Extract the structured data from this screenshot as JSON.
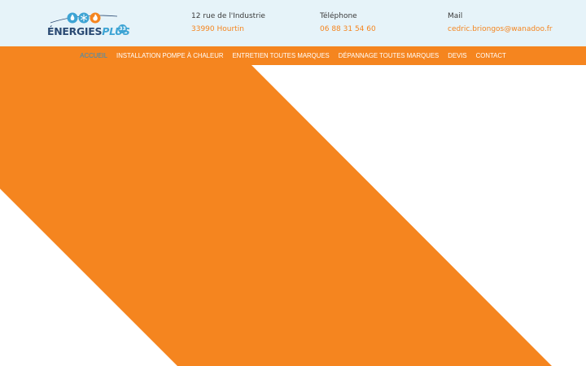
{
  "header": {
    "logo": {
      "word1": "ÉNERGIES",
      "word2": "PLUS",
      "badge": "33",
      "alt_icons": [
        "water-drop-icon",
        "snowflake-icon",
        "flame-icon"
      ]
    },
    "address": {
      "label": "12 rue de l'Industrie",
      "value": "33990 Hourtin"
    },
    "phone": {
      "label": "Téléphone",
      "value": "06 88 31 54 60"
    },
    "mail": {
      "label": "Mail",
      "value": "cedric.briongos@wanadoo.fr"
    }
  },
  "nav": {
    "items": [
      {
        "label": "ACCUEIL",
        "active": true
      },
      {
        "label": "INSTALLATION POMPE À CHALEUR",
        "active": false
      },
      {
        "label": "ENTRETIEN TOUTES MARQUES",
        "active": false
      },
      {
        "label": "DÉPANNAGE TOUTES MARQUES",
        "active": false
      },
      {
        "label": "DEVIS",
        "active": false
      },
      {
        "label": "CONTACT",
        "active": false
      }
    ]
  },
  "colors": {
    "accent": "#f5851f",
    "header_bg": "#e6f3f9",
    "active_link": "#2f8ec6",
    "logo_dark": "#2a4a73",
    "logo_light": "#3da4d4"
  }
}
